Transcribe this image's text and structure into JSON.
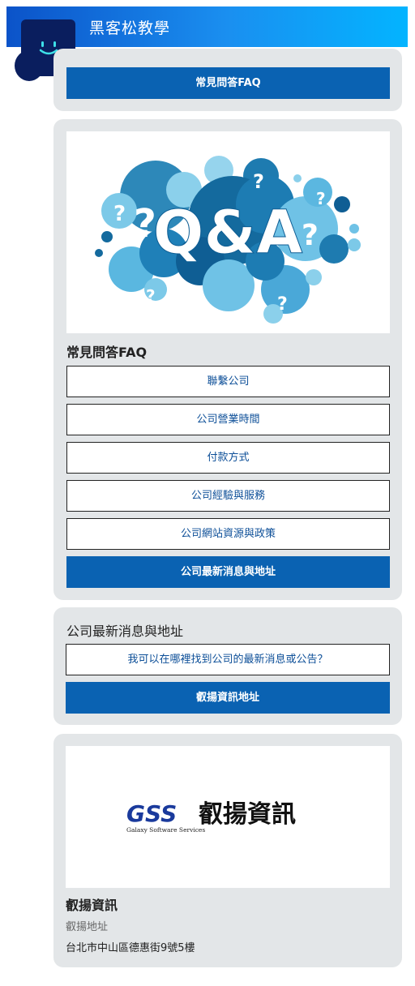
{
  "header": {
    "title": "黑客松教學"
  },
  "card1": {
    "button": "常見問答FAQ"
  },
  "faq": {
    "image_text": "Q&A",
    "title": "常見問答FAQ",
    "items": [
      {
        "label": "聯繫公司"
      },
      {
        "label": "公司營業時間"
      },
      {
        "label": "付款方式"
      },
      {
        "label": "公司經驗與服務"
      },
      {
        "label": "公司網站資源與政策"
      }
    ],
    "primary": "公司最新消息與地址"
  },
  "news": {
    "title": "公司最新消息與地址",
    "question": "我可以在哪裡找到公司的最新消息或公告？",
    "button": "叡揚資訊地址"
  },
  "company": {
    "logo_mark": "GSS",
    "logo_name": "叡揚資訊",
    "logo_sub": "Galaxy Software Services",
    "name": "叡揚資訊",
    "address_label": "叡揚地址",
    "address": "台北市中山區德惠街9號5樓"
  },
  "colors": {
    "primary": "#0a62b2",
    "card_bg": "#e3e6e8",
    "header_start": "#0b53c9",
    "header_end": "#03b4ff"
  }
}
